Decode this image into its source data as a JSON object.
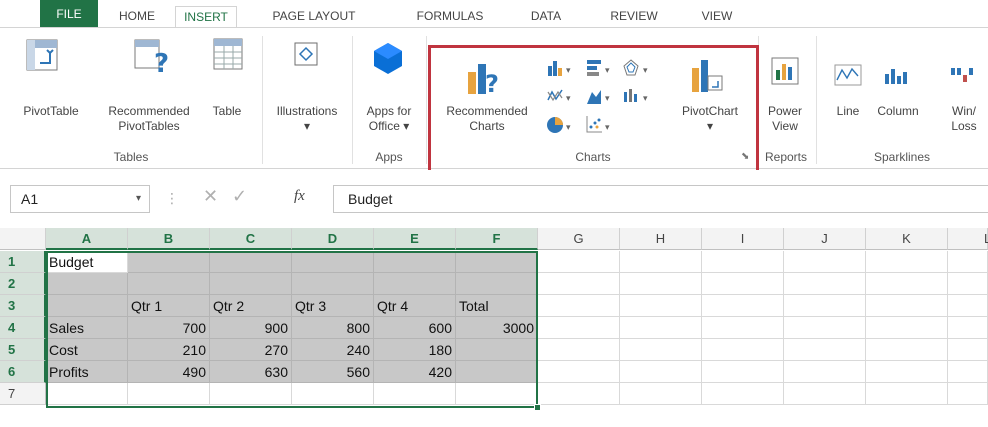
{
  "tabs": [
    "FILE",
    "HOME",
    "INSERT",
    "PAGE LAYOUT",
    "FORMULAS",
    "DATA",
    "REVIEW",
    "VIEW"
  ],
  "active_tab": "INSERT",
  "ribbon": {
    "tables": {
      "pivottable": "PivotTable",
      "recommended_l1": "Recommended",
      "recommended_l2": "PivotTables",
      "table": "Table",
      "group": "Tables"
    },
    "illustrations": {
      "label": "Illustrations"
    },
    "apps": {
      "apps_l1": "Apps for",
      "apps_l2": "Office",
      "group": "Apps"
    },
    "charts": {
      "rec_l1": "Recommended",
      "rec_l2": "Charts",
      "pivotchart": "PivotChart",
      "group": "Charts"
    },
    "reports": {
      "power_l1": "Power",
      "power_l2": "View",
      "group": "Reports"
    },
    "sparklines": {
      "line": "Line",
      "column": "Column",
      "winloss_l1": "Win/",
      "winloss_l2": "Loss",
      "group": "Sparklines"
    }
  },
  "formula_bar": {
    "name_box": "A1",
    "fx": "fx",
    "value": "Budget"
  },
  "grid": {
    "columns": [
      "A",
      "B",
      "C",
      "D",
      "E",
      "F",
      "G",
      "H",
      "I",
      "J",
      "K",
      "L"
    ],
    "rows": [
      "1",
      "2",
      "3",
      "4",
      "5",
      "6",
      "7"
    ],
    "r1": {
      "A": "Budget"
    },
    "r3": {
      "B": "Qtr 1",
      "C": "Qtr 2",
      "D": "Qtr 3",
      "E": "Qtr 4",
      "F": "Total"
    },
    "r4": {
      "A": "Sales",
      "B": "700",
      "C": "900",
      "D": "800",
      "E": "600",
      "F": "3000"
    },
    "r5": {
      "A": "Cost",
      "B": "210",
      "C": "270",
      "D": "240",
      "E": "180"
    },
    "r6": {
      "A": "Profits",
      "B": "490",
      "C": "630",
      "D": "560",
      "E": "420"
    }
  },
  "colors": {
    "excel_green": "#217346",
    "highlight_red": "#c0343f",
    "selection_gray": "#c8c8c8"
  }
}
